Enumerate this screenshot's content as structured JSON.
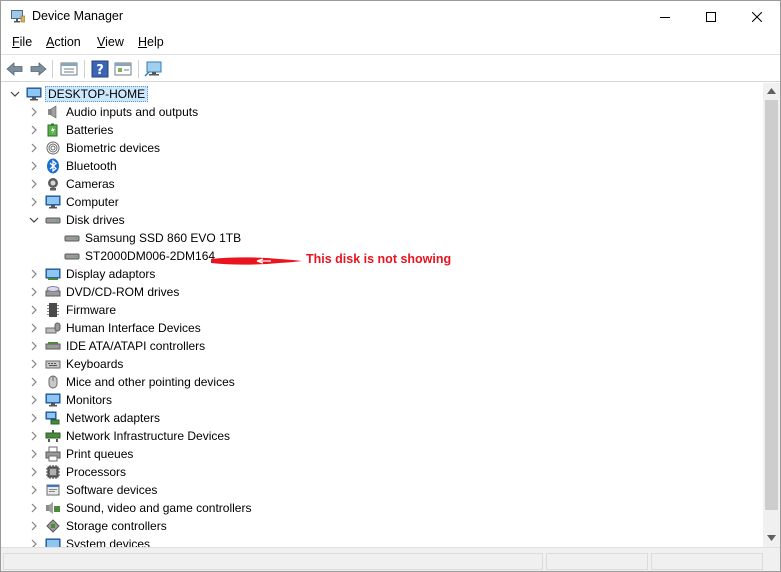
{
  "window": {
    "title": "Device Manager",
    "controls": {
      "minimize": "minimize",
      "maximize": "maximize",
      "close": "close"
    }
  },
  "menu": {
    "items": [
      {
        "accel": "F",
        "rest": "ile"
      },
      {
        "accel": "A",
        "rest": "ction"
      },
      {
        "accel": "V",
        "rest": "iew"
      },
      {
        "accel": "H",
        "rest": "elp"
      }
    ]
  },
  "toolbar": {
    "buttons": [
      "back-icon",
      "forward-icon",
      "properties-icon",
      "help-icon",
      "show-hidden-icon",
      "scan-hardware-icon"
    ]
  },
  "tree": {
    "root": "DESKTOP-HOME",
    "categories": [
      {
        "label": "Audio inputs and outputs",
        "icon": "speaker-icon",
        "expanded": false
      },
      {
        "label": "Batteries",
        "icon": "battery-icon",
        "expanded": false
      },
      {
        "label": "Biometric devices",
        "icon": "fingerprint-icon",
        "expanded": false
      },
      {
        "label": "Bluetooth",
        "icon": "bluetooth-icon",
        "expanded": false
      },
      {
        "label": "Cameras",
        "icon": "camera-icon",
        "expanded": false
      },
      {
        "label": "Computer",
        "icon": "computer-icon",
        "expanded": false
      },
      {
        "label": "Disk drives",
        "icon": "disk-drive-icon",
        "expanded": true,
        "children": [
          "Samsung SSD 860 EVO 1TB",
          "ST2000DM006-2DM164"
        ]
      },
      {
        "label": "Display adaptors",
        "icon": "display-adapter-icon",
        "expanded": false
      },
      {
        "label": "DVD/CD-ROM drives",
        "icon": "dvd-drive-icon",
        "expanded": false
      },
      {
        "label": "Firmware",
        "icon": "firmware-icon",
        "expanded": false
      },
      {
        "label": "Human Interface Devices",
        "icon": "hid-icon",
        "expanded": false
      },
      {
        "label": "IDE ATA/ATAPI controllers",
        "icon": "ide-controller-icon",
        "expanded": false
      },
      {
        "label": "Keyboards",
        "icon": "keyboard-icon",
        "expanded": false
      },
      {
        "label": "Mice and other pointing devices",
        "icon": "mouse-icon",
        "expanded": false
      },
      {
        "label": "Monitors",
        "icon": "monitor-icon",
        "expanded": false
      },
      {
        "label": "Network adapters",
        "icon": "network-adapter-icon",
        "expanded": false
      },
      {
        "label": "Network Infrastructure Devices",
        "icon": "network-infrastructure-icon",
        "expanded": false
      },
      {
        "label": "Print queues",
        "icon": "printer-icon",
        "expanded": false
      },
      {
        "label": "Processors",
        "icon": "processor-icon",
        "expanded": false
      },
      {
        "label": "Software devices",
        "icon": "software-device-icon",
        "expanded": false
      },
      {
        "label": "Sound, video and game controllers",
        "icon": "sound-controller-icon",
        "expanded": false
      },
      {
        "label": "Storage controllers",
        "icon": "storage-controller-icon",
        "expanded": false
      },
      {
        "label": "System devices",
        "icon": "system-device-icon",
        "expanded": false
      }
    ]
  },
  "annotation": {
    "text": "This disk is not showing",
    "color": "#e8141e"
  },
  "colors": {
    "selection": "#cce8ff",
    "accent": "#0078d7"
  }
}
